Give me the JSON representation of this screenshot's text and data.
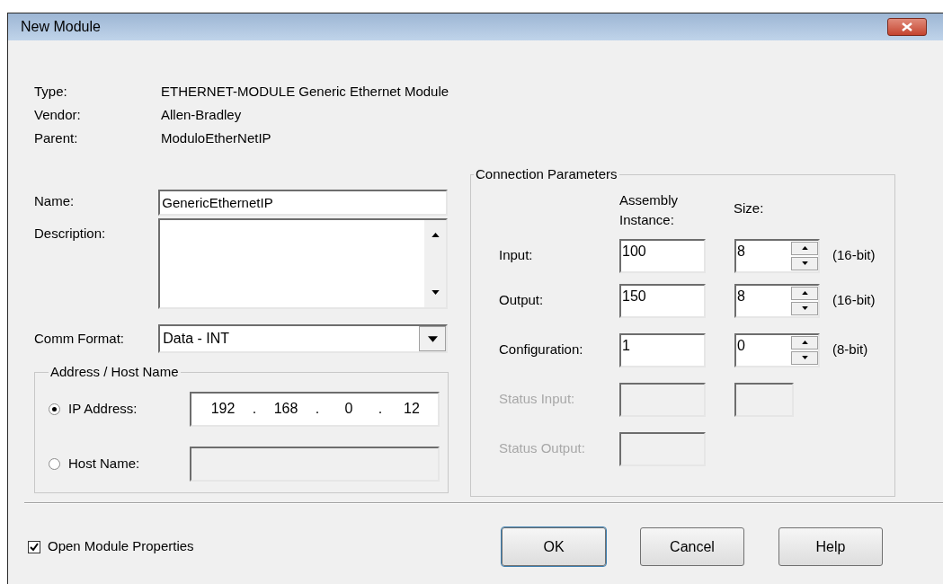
{
  "window": {
    "title": "New Module"
  },
  "info": [
    {
      "label": "Type:",
      "value": "ETHERNET-MODULE Generic Ethernet Module"
    },
    {
      "label": "Vendor:",
      "value": "Allen-Bradley"
    },
    {
      "label": "Parent:",
      "value": "ModuloEtherNetIP"
    }
  ],
  "name": {
    "label": "Name:",
    "value": "GenericEthernetIP"
  },
  "description": {
    "label": "Description:"
  },
  "comm_format": {
    "label": "Comm Format:",
    "value": "Data - INT"
  },
  "address": {
    "title": "Address / Host Name",
    "options": [
      {
        "label": "IP Address:",
        "selected": true,
        "kind": "ip",
        "octets": [
          "192",
          "168",
          "0",
          "12"
        ],
        "separators": [
          ".",
          ".",
          "."
        ]
      },
      {
        "label": "Host Name:",
        "selected": false,
        "kind": "text"
      }
    ]
  },
  "connection": {
    "title": "Connection Parameters",
    "columns": [
      "Assembly Instance:",
      "Size:"
    ],
    "rows": [
      {
        "label": "Input:",
        "disabled": false,
        "kind": "spin",
        "instance": "100",
        "size": "8",
        "unit": "(16-bit)"
      },
      {
        "label": "Output:",
        "disabled": false,
        "kind": "spin",
        "instance": "150",
        "size": "8",
        "unit": "(16-bit)"
      },
      {
        "label": "Configuration:",
        "disabled": false,
        "kind": "spin",
        "instance": "1",
        "size": "0",
        "unit": "(8-bit)"
      },
      {
        "label": "Status Input:",
        "disabled": true,
        "kind": "plain"
      },
      {
        "label": "Status Output:",
        "disabled": true,
        "kind": "none"
      }
    ]
  },
  "open_properties": {
    "label": "Open Module Properties",
    "checked": true
  },
  "buttons": [
    "OK",
    "Cancel",
    "Help"
  ]
}
